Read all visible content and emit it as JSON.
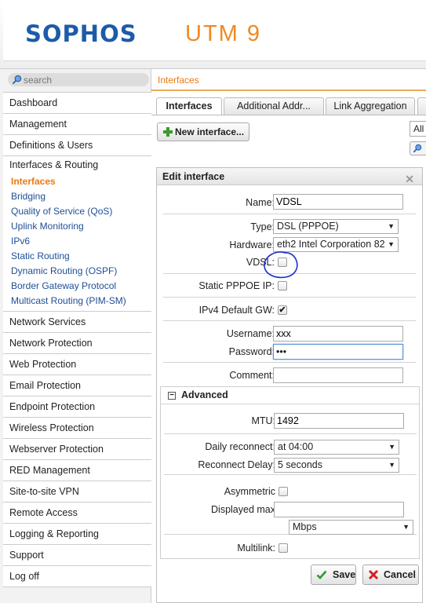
{
  "header": {
    "brand": "SOPHOS",
    "product": "UTM 9"
  },
  "sidebar": {
    "search_placeholder": "search",
    "items_top": [
      {
        "label": "Dashboard"
      },
      {
        "label": "Management"
      },
      {
        "label": "Definitions & Users"
      }
    ],
    "section": {
      "label": "Interfaces & Routing",
      "items": [
        {
          "label": "Interfaces",
          "active": true
        },
        {
          "label": "Bridging"
        },
        {
          "label": "Quality of Service (QoS)"
        },
        {
          "label": "Uplink Monitoring"
        },
        {
          "label": "IPv6"
        },
        {
          "label": "Static Routing"
        },
        {
          "label": "Dynamic Routing (OSPF)"
        },
        {
          "label": "Border Gateway Protocol"
        },
        {
          "label": "Multicast Routing (PIM-SM)"
        }
      ]
    },
    "items_bottom": [
      {
        "label": "Network Services"
      },
      {
        "label": "Network Protection"
      },
      {
        "label": "Web Protection"
      },
      {
        "label": "Email Protection"
      },
      {
        "label": "Endpoint Protection"
      },
      {
        "label": "Wireless Protection"
      },
      {
        "label": "Webserver Protection"
      },
      {
        "label": "RED Management"
      },
      {
        "label": "Site-to-site VPN"
      },
      {
        "label": "Remote Access"
      },
      {
        "label": "Logging & Reporting"
      },
      {
        "label": "Support"
      },
      {
        "label": "Log off"
      }
    ]
  },
  "main": {
    "breadcrumb": "Interfaces",
    "tabs": [
      {
        "label": "Interfaces",
        "active": true
      },
      {
        "label": "Additional Addr..."
      },
      {
        "label": "Link Aggregation"
      }
    ],
    "new_interface_label": "New interface...",
    "filter_value": "All"
  },
  "dialog": {
    "title": "Edit interface",
    "name_label": "Name:",
    "name_value": "VDSL",
    "type_label": "Type:",
    "type_value": "DSL (PPPOE)",
    "hardware_label": "Hardware:",
    "hardware_value": "eth2 Intel Corporation 82",
    "vdsl_label": "VDSL:",
    "vdsl_checked": false,
    "static_pppoe_label": "Static PPPOE IP:",
    "static_pppoe_checked": false,
    "ipv4_gw_label": "IPv4 Default GW:",
    "ipv4_gw_checked": true,
    "username_label": "Username:",
    "username_value": "xxx",
    "password_label": "Password:",
    "password_value": "•••",
    "comment_label": "Comment:",
    "comment_value": "",
    "advanced": {
      "title": "Advanced",
      "mtu_label": "MTU:",
      "mtu_value": "1492",
      "daily_reconnect_label": "Daily reconnect:",
      "daily_reconnect_value": "at 04:00",
      "reconnect_delay_label": "Reconnect Delay:",
      "reconnect_delay_value": "5 seconds",
      "asymmetric_label": "Asymmetric",
      "asymmetric_checked": false,
      "displayed_max_label": "Displayed max",
      "displayed_max_value": "",
      "unit_value": "Mbps",
      "multilink_label": "Multilink:",
      "multilink_checked": false
    },
    "save_label": "Save",
    "cancel_label": "Cancel"
  },
  "colors": {
    "brand_blue": "#1c5ba8",
    "accent_orange": "#e87a12",
    "link_blue": "#1f4e96"
  }
}
